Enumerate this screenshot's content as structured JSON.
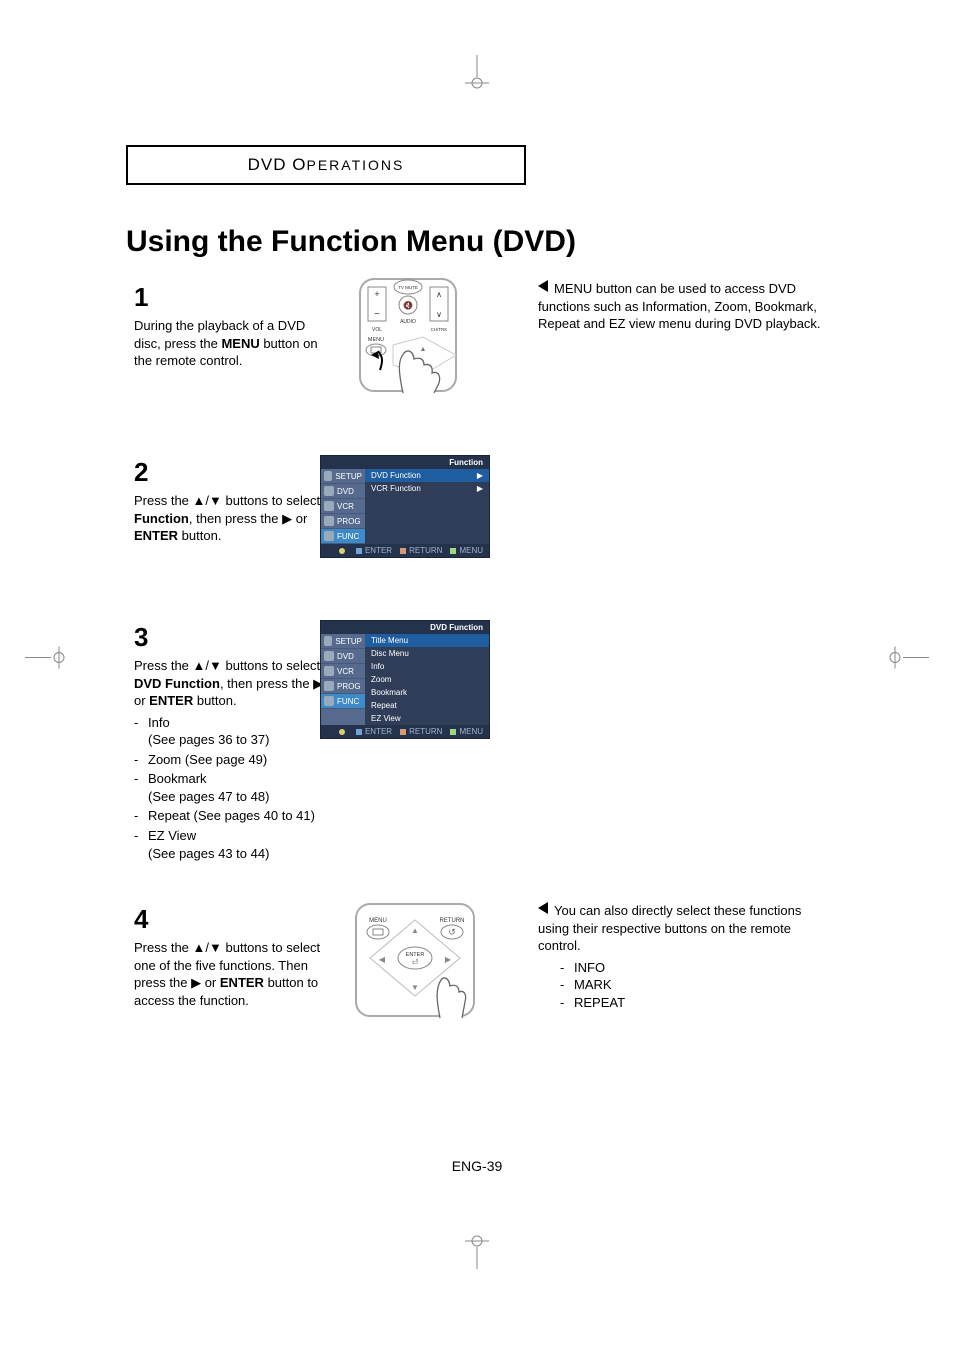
{
  "header": {
    "prefix": "DVD O",
    "rest": "PERATIONS"
  },
  "title": "Using the Function Menu (DVD)",
  "steps": {
    "s1": {
      "num": "1",
      "text_a": "During the playback of a DVD disc, press the ",
      "menu_word": "MENU",
      "text_b": " button on the remote control."
    },
    "s2": {
      "num": "2",
      "text_a": "Press the ",
      "arrows": "▲/▼",
      "text_b": " buttons to select ",
      "bold1": "Function",
      "text_c": ", then press the ",
      "play": "▶",
      "text_d": " or ",
      "bold2": "ENTER",
      "text_e": " button."
    },
    "s3": {
      "num": "3",
      "text_a": "Press the ",
      "arrows": "▲/▼",
      "text_b": " buttons to select ",
      "bold1": "DVD Function",
      "text_c": ", then press the ",
      "play": "▶",
      "text_d": " or ",
      "bold2": "ENTER",
      "text_e": " button.",
      "items": [
        {
          "label": "Info",
          "ref": "(See pages 36 to 37)"
        },
        {
          "label": "Zoom (See page 49)",
          "ref": ""
        },
        {
          "label": "Bookmark",
          "ref": "(See pages 47 to 48)"
        },
        {
          "label": "Repeat (See pages 40 to 41)",
          "ref": ""
        },
        {
          "label": "EZ View",
          "ref": "(See pages 43 to 44)"
        }
      ]
    },
    "s4": {
      "num": "4",
      "text_a": "Press the ",
      "arrows": "▲/▼",
      "text_b": " buttons to select one of the five functions. Then press the ",
      "play": "▶",
      "text_c": " or ",
      "bold1": "ENTER",
      "text_d": " button to access the function."
    }
  },
  "notes": {
    "n1": "MENU button can be used to access DVD functions such as Information, Zoom, Bookmark, Repeat and EZ view menu during DVD playback.",
    "n2": {
      "text": "You can also directly select these functions using their respective buttons on the remote control.",
      "items": [
        "INFO",
        "MARK",
        "REPEAT"
      ]
    }
  },
  "osd1": {
    "header": "Function",
    "left": [
      "SETUP",
      "DVD",
      "VCR",
      "PROG",
      "FUNC"
    ],
    "left_sel": 4,
    "right": [
      {
        "label": "DVD Function",
        "icon": "▶"
      },
      {
        "label": "VCR Function",
        "icon": "▶"
      }
    ],
    "right_sel": 0,
    "footer": {
      "move": "",
      "enter": "ENTER",
      "ret": "RETURN",
      "menu": "MENU"
    }
  },
  "osd2": {
    "header": "DVD Function",
    "left": [
      "SETUP",
      "DVD",
      "VCR",
      "PROG",
      "FUNC"
    ],
    "left_sel": 4,
    "right": [
      {
        "label": "Title Menu",
        "icon": ""
      },
      {
        "label": "Disc Menu",
        "icon": ""
      },
      {
        "label": "Info",
        "icon": ""
      },
      {
        "label": "Zoom",
        "icon": ""
      },
      {
        "label": "Bookmark",
        "icon": ""
      },
      {
        "label": "Repeat",
        "icon": ""
      },
      {
        "label": "EZ View",
        "icon": ""
      }
    ],
    "right_sel": 0,
    "footer": {
      "move": "",
      "enter": "ENTER",
      "ret": "RETURN",
      "menu": "MENU"
    }
  },
  "remote1": {
    "tvmute": "TV MUTE",
    "vol": "VOL",
    "ch": "CH/TRK",
    "audio": "AUDIO",
    "menu": "MENU"
  },
  "remote2": {
    "menu": "MENU",
    "return": "RETURN",
    "enter": "ENTER"
  },
  "pagenum": "ENG-39"
}
